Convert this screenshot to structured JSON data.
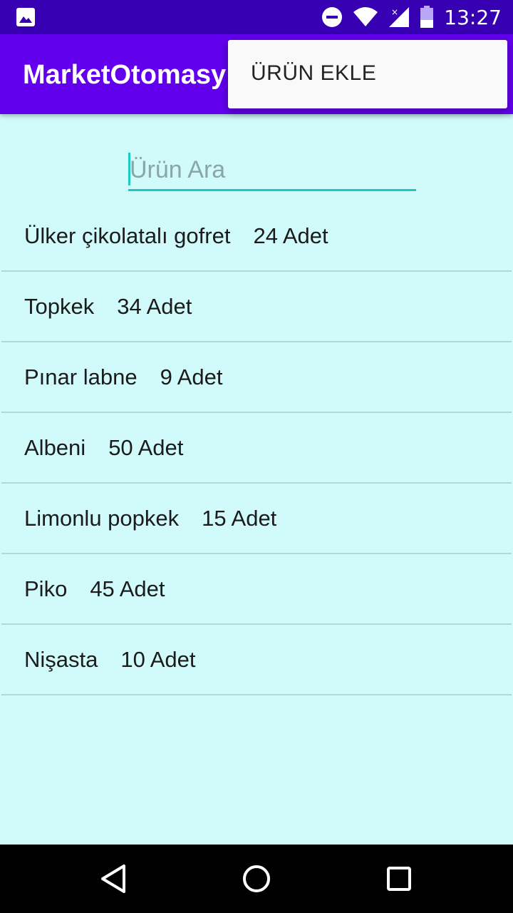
{
  "status_bar": {
    "time": "13:27",
    "icons": [
      "image-notification-icon",
      "do-not-disturb-icon",
      "wifi-icon",
      "signal-icon",
      "battery-icon"
    ]
  },
  "app_bar": {
    "title": "MarketOtomasy"
  },
  "overflow_menu": {
    "items": [
      {
        "label": "ÜRÜN EKLE"
      }
    ]
  },
  "search": {
    "placeholder": "Ürün Ara",
    "value": ""
  },
  "products": [
    {
      "name": "Ülker çikolatalı gofret",
      "qty": "24 Adet"
    },
    {
      "name": "Topkek",
      "qty": "34 Adet"
    },
    {
      "name": "Pınar labne",
      "qty": "9 Adet"
    },
    {
      "name": "Albeni",
      "qty": "50 Adet"
    },
    {
      "name": "Limonlu popkek",
      "qty": "15 Adet"
    },
    {
      "name": "Piko",
      "qty": "45 Adet"
    },
    {
      "name": "Nişasta",
      "qty": "10 Adet"
    }
  ],
  "nav_bar": {
    "buttons": [
      "back-icon",
      "home-icon",
      "recents-icon"
    ]
  },
  "colors": {
    "status_bar": "#3700b3",
    "app_bar": "#6200ee",
    "background": "#d1fbfb",
    "accent": "#1ccbc0"
  }
}
